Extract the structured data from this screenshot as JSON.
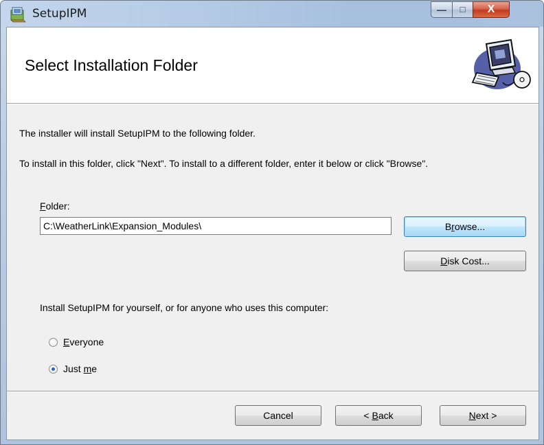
{
  "window": {
    "title": "SetupIPM",
    "controls": {
      "minimize": "—",
      "maximize": "□",
      "close": "X"
    }
  },
  "header": {
    "title": "Select Installation Folder",
    "art_icon": "computer-disc-icon"
  },
  "body": {
    "line1": "The installer will install SetupIPM to the following folder.",
    "line2": "To install in this folder, click \"Next\". To install to a different folder, enter it below or click \"Browse\".",
    "folder_label_mnemonic": "F",
    "folder_label_rest": "older:",
    "folder_value": "C:\\WeatherLink\\Expansion_Modules\\",
    "browse": {
      "pre": "B",
      "mnemonic": "r",
      "post": "owse..."
    },
    "disk_cost": {
      "mnemonic": "D",
      "post": "isk Cost..."
    },
    "install_for": "Install SetupIPM for yourself, or for anyone who uses this computer:",
    "radio_everyone": {
      "mnemonic": "E",
      "post": "veryone",
      "selected": false
    },
    "radio_justme": {
      "pre": "Just ",
      "mnemonic": "m",
      "post": "e",
      "selected": true
    }
  },
  "footer": {
    "cancel": "Cancel",
    "back": {
      "pre": "< ",
      "mnemonic": "B",
      "post": "ack"
    },
    "next": {
      "mnemonic": "N",
      "post": "ext >"
    }
  },
  "colors": {
    "accent": "#2867b4",
    "close_button": "#c13a1e"
  }
}
